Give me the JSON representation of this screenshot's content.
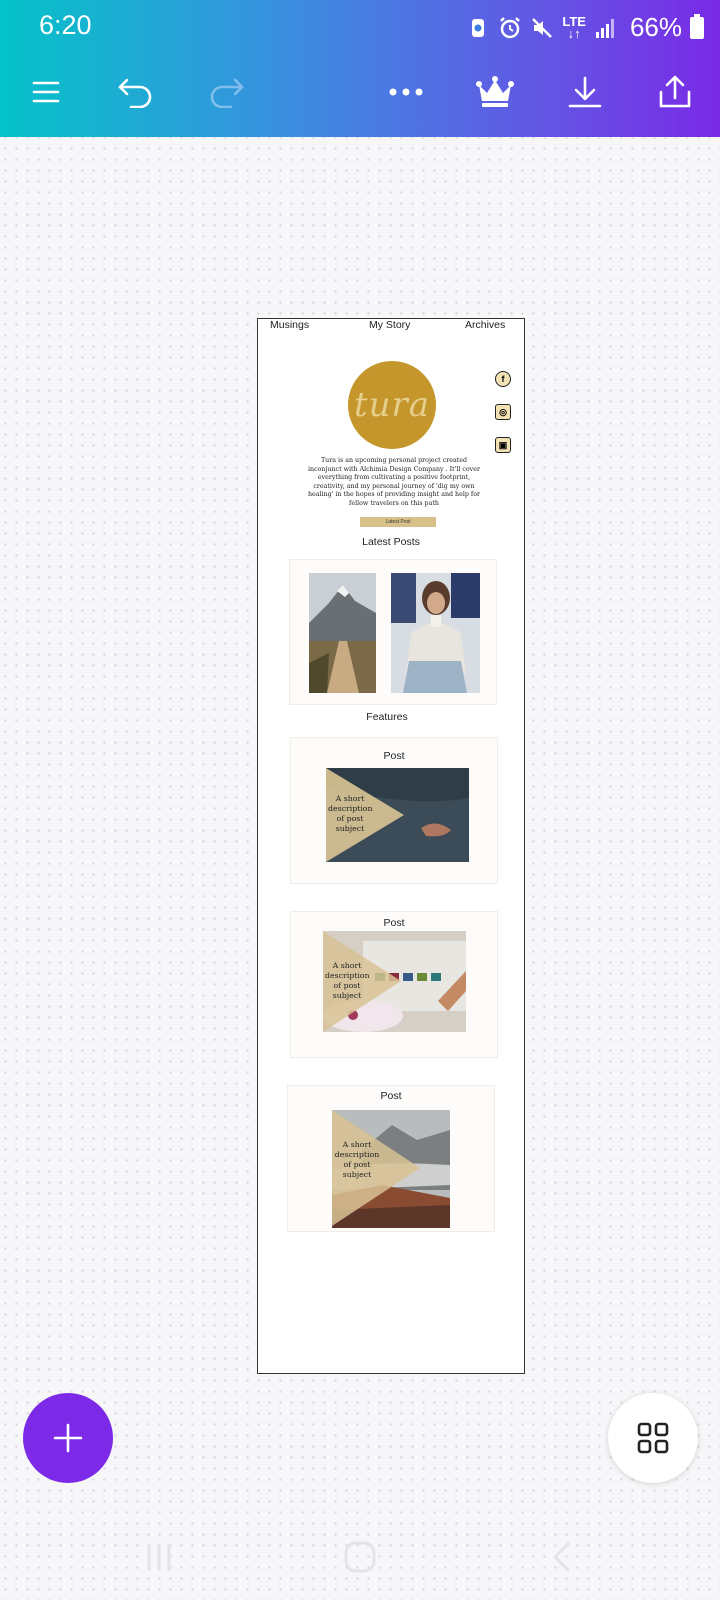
{
  "status": {
    "time": "6:20",
    "network": "LTE",
    "battery": "66%"
  },
  "toolbar": {
    "menu_icon": "hamburger-icon",
    "undo_icon": "undo-icon",
    "redo_icon": "redo-icon",
    "more_icon": "more-dots-icon",
    "premium_icon": "crown-icon",
    "download_icon": "download-icon",
    "share_icon": "share-icon",
    "accent": "#7d2ae8"
  },
  "design": {
    "nav": [
      "Musings",
      "My Story",
      "Archives"
    ],
    "logo_text": "tura",
    "blurb": "Tura is an upcoming personal project created inconjunct with Alchimia Design Company . It'll cover everything from cultivating a positive footprint, creativity, and my personal journey of 'dig my own healing' in the hopes of providing insight and help for fellow travelers on this path",
    "latest_button": "Latest Post",
    "latest_title": "Latest Posts",
    "features_title": "Features",
    "posts": [
      {
        "label": "Post",
        "caption": "A short description of post subject"
      },
      {
        "label": "Post",
        "caption": "A short description of post subject"
      },
      {
        "label": "Post",
        "caption": "A short description of post subject"
      }
    ],
    "social_icons": [
      "facebook-icon",
      "instagram-icon",
      "camera-icon"
    ],
    "logo_color": "#c4962c"
  },
  "fab": {
    "icon": "plus-icon"
  },
  "pages_button": {
    "icon": "grid-icon"
  },
  "system_nav": [
    "recents-icon",
    "home-icon",
    "back-icon"
  ]
}
